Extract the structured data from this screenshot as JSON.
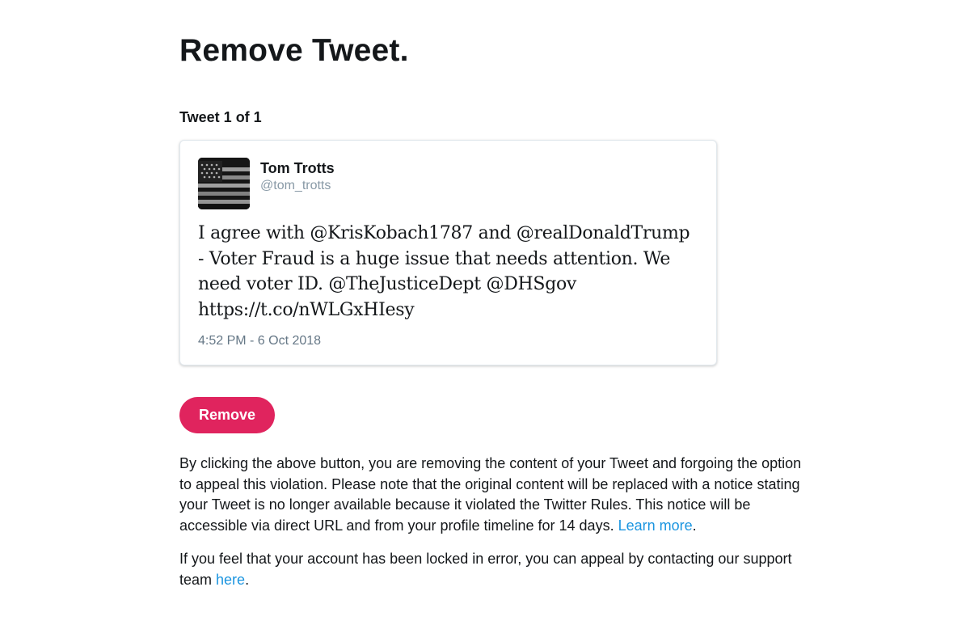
{
  "page": {
    "title": "Remove Tweet.",
    "counter": "Tweet 1 of 1"
  },
  "tweet": {
    "display_name": "Tom Trotts",
    "screen_name": "@tom_trotts",
    "avatar_icon": "american-flag-avatar",
    "text": "I agree with @KrisKobach1787 and @realDonaldTrump - Voter Fraud is a huge issue that needs attention. We need voter ID. @TheJusticeDept @DHSgov https://t.co/nWLGxHIesy",
    "timestamp": "4:52 PM - 6 Oct 2018"
  },
  "actions": {
    "remove_label": "Remove"
  },
  "notice": {
    "paragraph1_text": "By clicking the above button, you are removing the content of your Tweet and forgoing the option to appeal this violation. Please note that the original content will be replaced with a notice stating your Tweet is no longer available because it violated the Twitter Rules. This notice will be accessible via direct URL and from your profile timeline for 14 days. ",
    "paragraph1_link": "Learn more",
    "paragraph1_end": ".",
    "paragraph2_text": "If you feel that your account has been locked in error, you can appeal by contacting our support team ",
    "paragraph2_link": "here",
    "paragraph2_end": "."
  },
  "colors": {
    "accent": "#e0245e",
    "link": "#1b95e0",
    "text": "#14171a",
    "muted": "#8899a6"
  }
}
